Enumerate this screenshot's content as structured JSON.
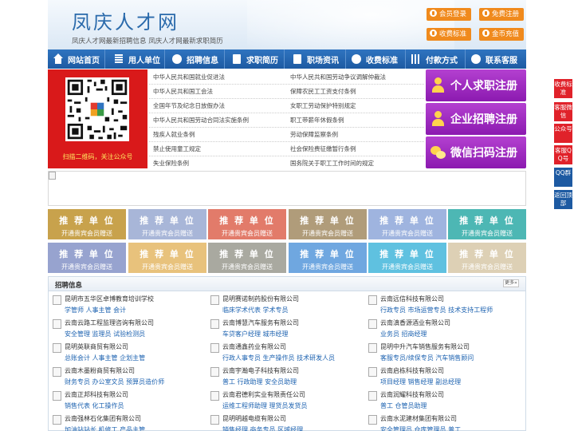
{
  "header": {
    "logo": "凤庆人才网",
    "slogan": "凤庆人才网最新招聘信息   凤庆人才网最新求职简历",
    "buttons": [
      "会员登录",
      "免费注册",
      "收费标准",
      "金币充值"
    ]
  },
  "nav": {
    "items": [
      {
        "label": "网站首页",
        "icon": "home-icon"
      },
      {
        "label": "用人单位",
        "icon": "building-icon"
      },
      {
        "label": "招聘信息",
        "icon": "megaphone-icon"
      },
      {
        "label": "求职简历",
        "icon": "resume-icon"
      },
      {
        "label": "职场资讯",
        "icon": "news-icon"
      },
      {
        "label": "收费标准",
        "icon": "fee-icon"
      },
      {
        "label": "付款方式",
        "icon": "payment-icon"
      },
      {
        "label": "联系客服",
        "icon": "phone-icon"
      }
    ]
  },
  "qr": {
    "caption": "扫描二维码，关注公众号"
  },
  "laws": [
    "中华人民共和国就业促进法",
    "中华人民共和国劳动争议调解仲裁法",
    "中华人民共和国工会法",
    "保障农民工工资支付条例",
    "全国年节及纪念日放假办法",
    "女职工劳动保护特别规定",
    "中华人民共和国劳动合同法实施条例",
    "职工带薪年休假条例",
    "残疾人就业条例",
    "劳动保障监察条例",
    "禁止使用童工规定",
    "社会保险费征缴暂行条例",
    "失业保险条例",
    "国务院关于职工工作时间的规定"
  ],
  "register": [
    {
      "label": "个人求职注册",
      "icon": "person-icon"
    },
    {
      "label": "企业招聘注册",
      "icon": "company-icon"
    },
    {
      "label": "微信扫码注册",
      "icon": "wechat-icon"
    }
  ],
  "recommend": {
    "title": "推 荐 单 位",
    "subtitle": "开通贵宾会员赠送",
    "colors": [
      "#c8a24c",
      "#a8b6d8",
      "#e27b6a",
      "#b09c7a",
      "#9fb4df",
      "#4db7b4",
      "#97a3cf",
      "#e8c27c",
      "#a9a9a0",
      "#6fa7e0",
      "#5fc1e0",
      "#ddd0b5"
    ]
  },
  "jobs": {
    "title": "招聘信息",
    "more": "更多»",
    "items": [
      {
        "company": "昆明市五华区卓博教育培训学校",
        "positions": "学管师 人事主管 会计"
      },
      {
        "company": "昆明赛诺制药股份有限公司",
        "positions": "临床学术代表 学术专员"
      },
      {
        "company": "云南远信科技有限公司",
        "positions": "行政专员 市场运营专员 技术支持工程师"
      },
      {
        "company": "云南云路工程监理咨询有限公司",
        "positions": "安全管理 监理员 试验检测员"
      },
      {
        "company": "云南博慧汽车服务有限公司",
        "positions": "车贷客户经理 城市经理"
      },
      {
        "company": "云南滇香源酒业有限公司",
        "positions": "业务员 招商经理"
      },
      {
        "company": "昆明英联商贸有限公司",
        "positions": "总账会计 人事主管 企划主管"
      },
      {
        "company": "云南通鑫药业有限公司",
        "positions": "行政人事专员 生产操作员 技术研发人员"
      },
      {
        "company": "昆明中升汽车销售服务有限公司",
        "positions": "客服专员/续保专员 汽车销售顾问"
      },
      {
        "company": "云南木墨粉商贸有限公司",
        "positions": "财务专员 办公室文员 预算员造价师"
      },
      {
        "company": "云南宇瀚电子科技有限公司",
        "positions": "普工 行政助理 安全员助理"
      },
      {
        "company": "云南启栋科技有限公司",
        "positions": "项目经理 销售经理 副总经理"
      },
      {
        "company": "云南正邦科技有限公司",
        "positions": "销售代表 化工操作员"
      },
      {
        "company": "云南君德利实业有限责任公司",
        "positions": "运维工程师助理 理货员发货员"
      },
      {
        "company": "云南润耀科技有限公司",
        "positions": "普工 仓管员助理"
      },
      {
        "company": "云南强林石化集团有限公司",
        "positions": "加油站站长 机修工 产品主管"
      },
      {
        "company": "昆明明越电缆有限公司",
        "positions": "销售经理 商务专员 区域经理"
      },
      {
        "company": "云南水泥建材集团有限公司",
        "positions": "安全管理员 仓库管理员 普工"
      }
    ]
  },
  "float_bar": [
    {
      "label": "收费标准",
      "color": "#e0222a"
    },
    {
      "label": "客服微信",
      "color": "#e0222a"
    },
    {
      "label": "公众号",
      "color": "#e0222a"
    },
    {
      "label": "客服QQ号",
      "color": "#e0222a"
    },
    {
      "label": "QQ群",
      "color": "#1d5aa2"
    },
    {
      "label": "返回顶部",
      "color": "#1d5aa2"
    }
  ]
}
